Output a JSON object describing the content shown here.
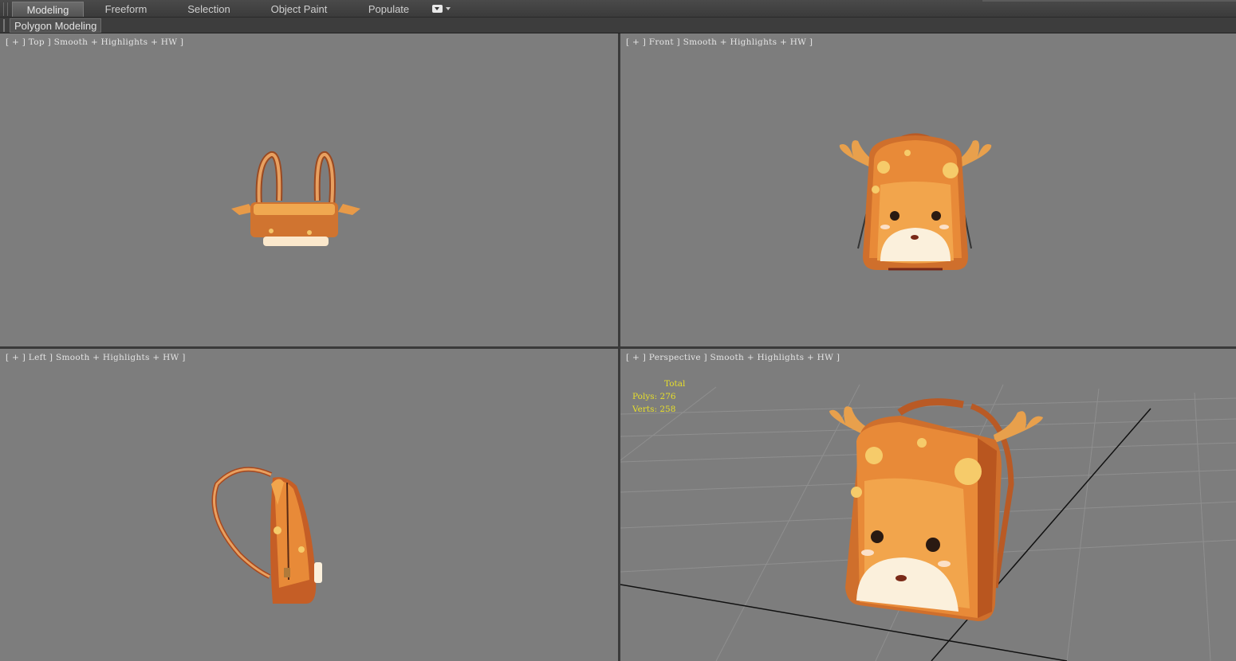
{
  "ribbon": {
    "tabs": [
      {
        "label": "Modeling",
        "active": true
      },
      {
        "label": "Freeform"
      },
      {
        "label": "Selection"
      },
      {
        "label": "Object Paint"
      },
      {
        "label": "Populate"
      }
    ]
  },
  "panel": {
    "label": "Polygon Modeling"
  },
  "viewports": {
    "top": {
      "label": "[ + ] Top ] Smooth + Highlights + HW ]"
    },
    "front": {
      "label": "[ + ] Front ] Smooth + Highlights + HW ]"
    },
    "left": {
      "label": "[ + ] Left ] Smooth + Highlights + HW ]"
    },
    "perspective": {
      "label": "[ + ] Perspective ] Smooth + Highlights + HW ]",
      "stats": {
        "total": "Total",
        "polys": "Polys: 276",
        "verts": "Verts: 258"
      }
    }
  },
  "colors": {
    "viewport_bg": "#7d7d7d",
    "stats_text": "#e7df2a",
    "model_orange": "#e08a3a",
    "model_dark": "#a8481e",
    "model_cream": "#fbeed8"
  }
}
